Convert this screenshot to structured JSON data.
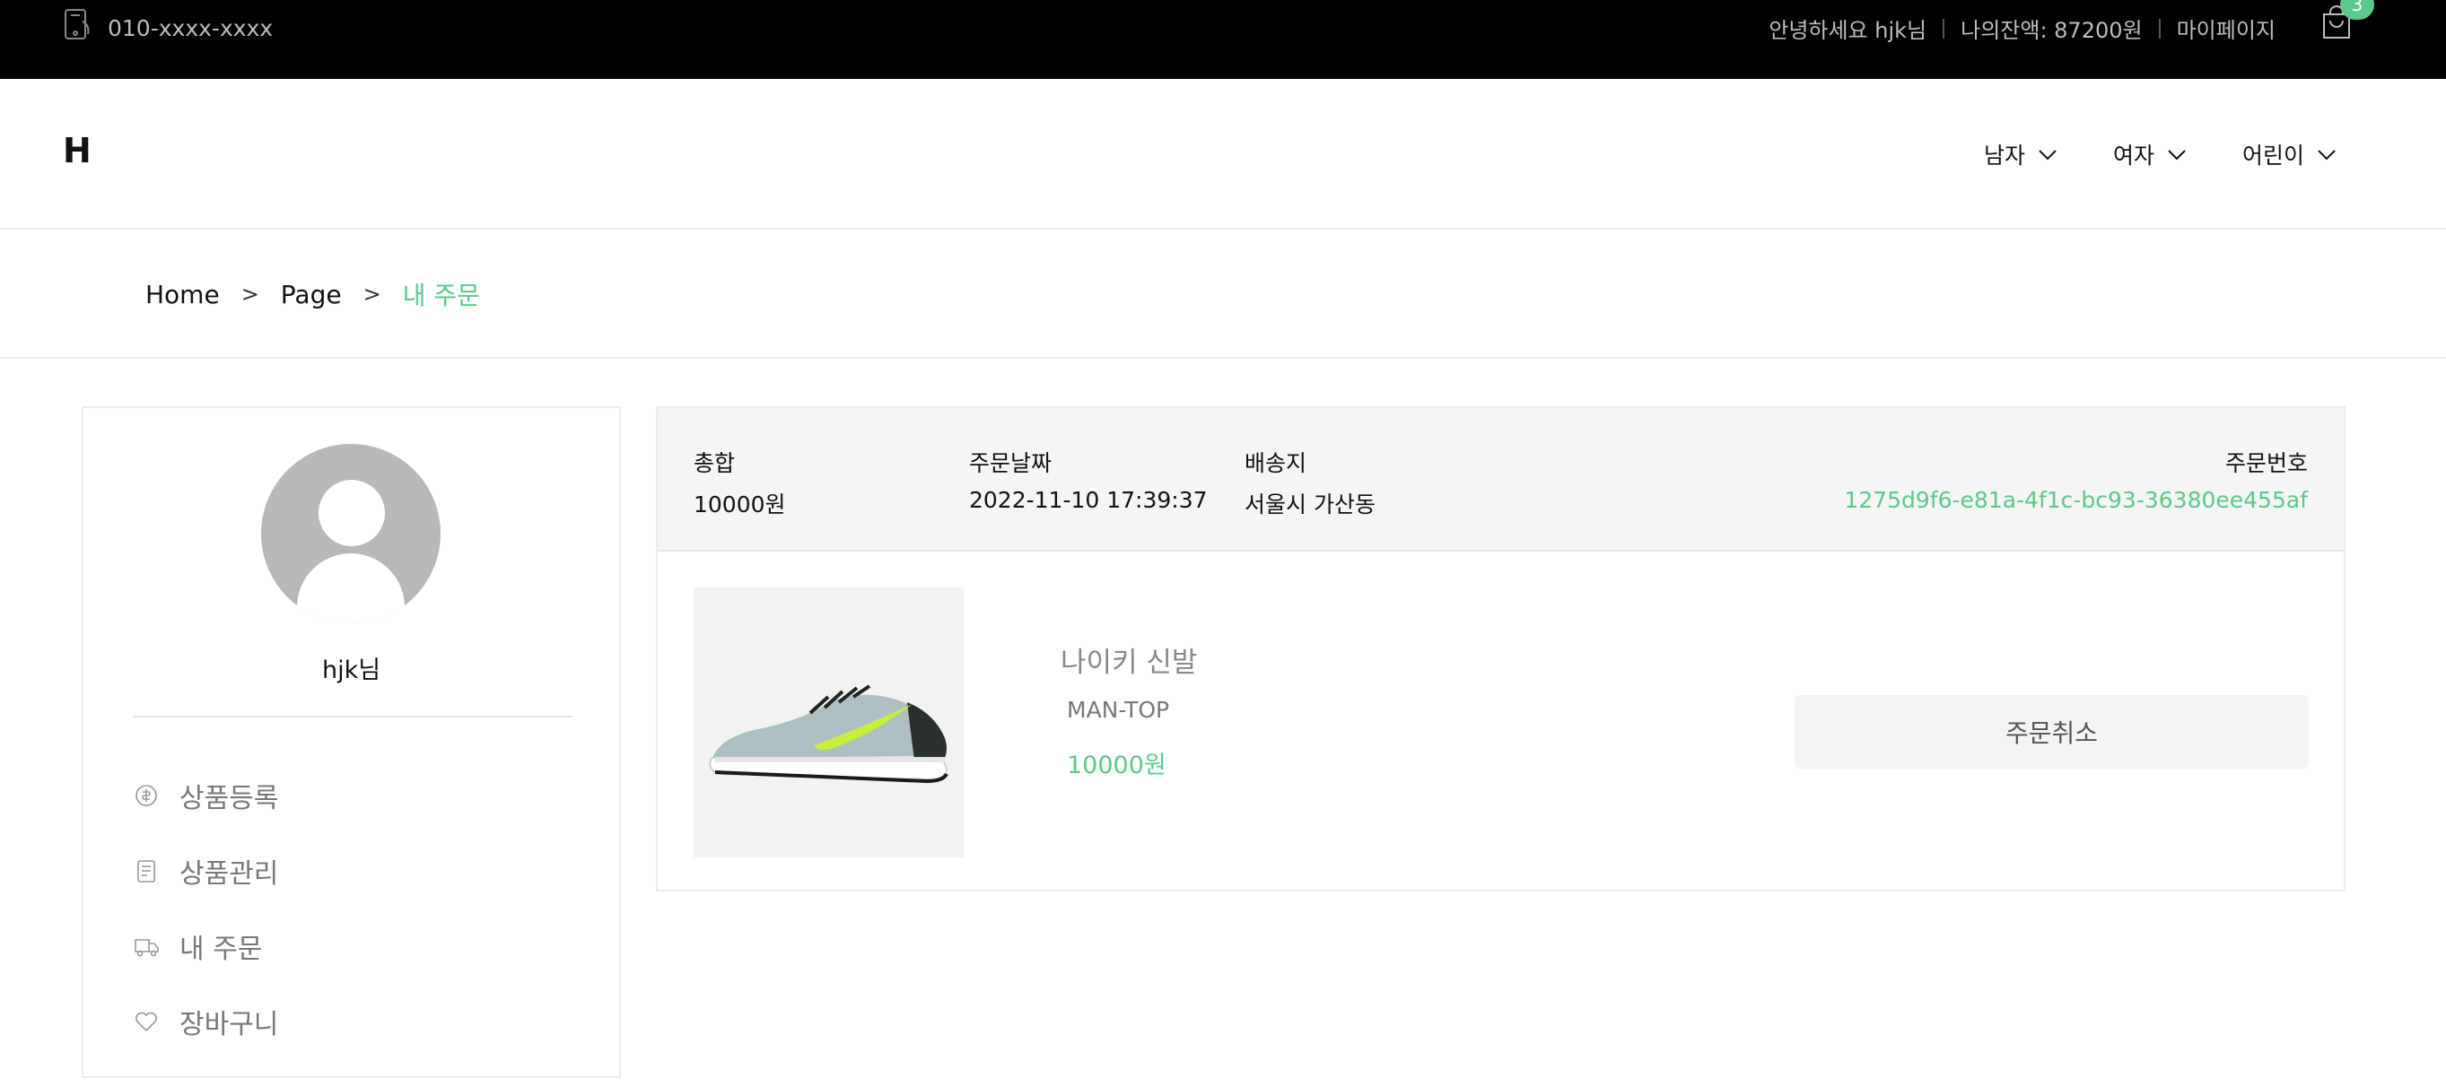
{
  "topbar": {
    "phone": "010-xxxx-xxxx",
    "greeting": "안녕하세요 hjk님",
    "balance": "나의잔액: 87200원",
    "mypage": "마이페이지",
    "cart_count": "3"
  },
  "header": {
    "logo": "H",
    "nav": [
      {
        "label": "남자"
      },
      {
        "label": "여자"
      },
      {
        "label": "어린이"
      }
    ]
  },
  "breadcrumb": {
    "items": [
      "Home",
      "Page",
      "내 주문"
    ]
  },
  "sidebar": {
    "username": "hjk님",
    "menu": [
      {
        "label": "상품등록",
        "icon": "product-register-icon"
      },
      {
        "label": "상품관리",
        "icon": "product-manage-icon"
      },
      {
        "label": "내 주문",
        "icon": "delivery-truck-icon"
      },
      {
        "label": "장바구니",
        "icon": "heart-icon"
      }
    ]
  },
  "order": {
    "total_label": "총합",
    "total_value": "10000원",
    "date_label": "주문날짜",
    "date_value": "2022-11-10 17:39:37",
    "address_label": "배송지",
    "address_value": "서울시 가산동",
    "order_no_label": "주문번호",
    "order_no_value": "1275d9f6-e81a-4f1c-bc93-36380ee455af",
    "product": {
      "name": "나이키 신발",
      "category": "MAN-TOP",
      "price": "10000원"
    },
    "cancel_label": "주문취소"
  },
  "colors": {
    "accent": "#5cc98a",
    "topbar_bg": "#000000"
  }
}
